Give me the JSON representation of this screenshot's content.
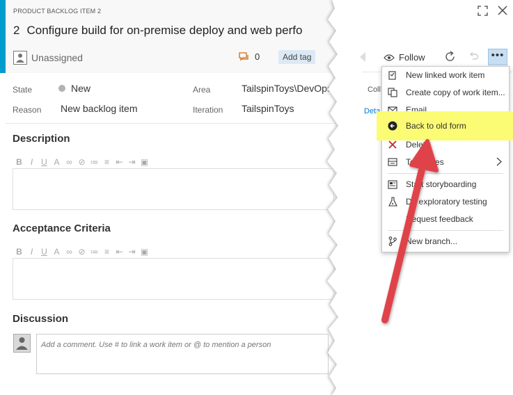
{
  "work_item": {
    "type_label": "PRODUCT BACKLOG ITEM 2",
    "number": "2",
    "title": "Configure build for on-premise deploy and web perfo",
    "assigned_to": "Unassigned",
    "comment_count": "0",
    "add_tag_label": "Add tag"
  },
  "fields": {
    "state_label": "State",
    "state_value": "New",
    "reason_label": "Reason",
    "reason_value": "New backlog item",
    "area_label": "Area",
    "area_value": "TailspinToys\\DevOps",
    "iteration_label": "Iteration",
    "iteration_value": "TailspinToys"
  },
  "sections": {
    "description": "Description",
    "acceptance": "Acceptance Criteria",
    "discussion": "Discussion",
    "comment_placeholder": "Add a comment. Use # to link a work item or @ to mention a person"
  },
  "toolbar": {
    "follow_label": "Follow",
    "more_label": "•••"
  },
  "behind_menu": {
    "tab_partial": "Coll",
    "link_partial": "Deta"
  },
  "menu": {
    "items": [
      {
        "label": "New linked work item",
        "icon": "new-linked-icon"
      },
      {
        "label": "Create copy of work item...",
        "icon": "copy-icon"
      },
      {
        "label": "Email...",
        "icon": "email-icon"
      },
      {
        "label": "Back to old form",
        "icon": "back-arrow-icon"
      },
      {
        "label": "Delete",
        "icon": "delete-x-icon"
      },
      {
        "label": "Templates",
        "icon": "templates-icon"
      },
      {
        "label": "Start storyboarding",
        "icon": "storyboard-icon"
      },
      {
        "label": "Do exploratory testing",
        "icon": "flask-icon"
      },
      {
        "label": "Request feedback",
        "icon": "feedback-icon"
      },
      {
        "label": "New branch...",
        "icon": "branch-icon"
      }
    ]
  },
  "colors": {
    "accent": "#009ccc",
    "highlight": "#fbfb74",
    "arrow": "#e0434a"
  }
}
